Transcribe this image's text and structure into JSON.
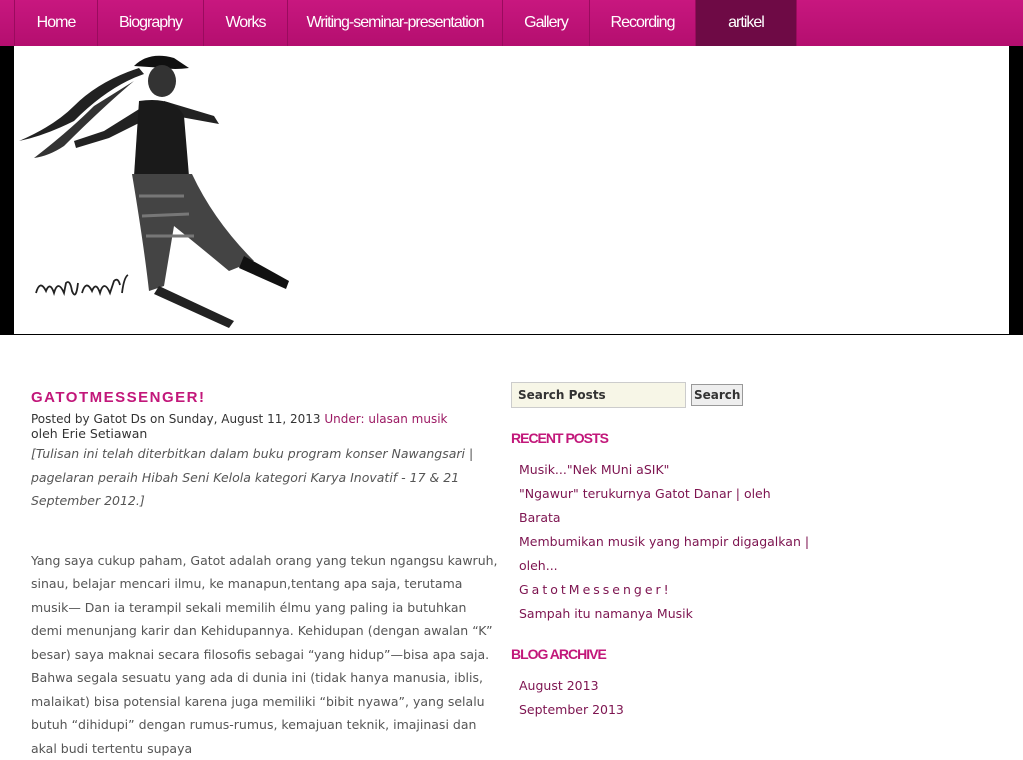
{
  "nav": {
    "items": [
      "Home",
      "Biography",
      "Works",
      "Writing-seminar-presentation",
      "Gallery",
      "Recording",
      "artikel"
    ],
    "active": "artikel"
  },
  "header": {
    "signature_script": "ꦒꦠꦺꦴꦠ꧀"
  },
  "post": {
    "title": "GATOTMESSENGER!",
    "meta_prefix": "Posted by Gatot Ds on Sunday, August 11, 2013",
    "under_label": "Under:",
    "category": "ulasan musik",
    "byline": "oleh Erie Setiawan",
    "note": "[Tulisan ini telah diterbitkan dalam buku program konser Nawangsari | pagelaran peraih Hibah Seni Kelola kategori Karya Inovatif - 17 & 21 September 2012.]",
    "body": "Yang saya cukup paham, Gatot adalah orang yang tekun ngangsu kawruh, sinau, belajar mencari ilmu, ke manapun,tentang apa saja, terutama musik— Dan ia terampil sekali memilih élmu yang paling ia butuhkan demi menunjang karir dan Kehidupannya. Kehidupan (dengan awalan “K” besar) saya maknai secara filosofis sebagai “yang hidup”—bisa apa saja. Bahwa segala sesuatu yang ada di dunia ini (tidak hanya manusia, iblis, malaikat) bisa potensial karena juga memiliki “bibit nyawa”, yang selalu butuh “dihidupi” dengan rumus-rumus, kemajuan teknik, imajinasi dan akal budi tertentu supaya"
  },
  "sidebar": {
    "search": {
      "value": "Search Posts",
      "button": "Search"
    },
    "recent_title": "RECENT POSTS",
    "recent_posts": [
      "Musik...\"Nek MUni aSIK\"",
      "\"Ngawur\" terukurnya Gatot Danar | oleh Barata",
      "Membumikan musik yang hampir digagalkan | oleh...",
      "GatotMessenger!",
      "Sampah itu namanya Musik"
    ],
    "archive_title": "BLOG ARCHIVE",
    "archive": [
      "August 2013",
      "September 2013"
    ]
  },
  "colors": {
    "accent": "#c2177a",
    "nav": "#b40e6f",
    "nav_active": "#6e0a45"
  }
}
